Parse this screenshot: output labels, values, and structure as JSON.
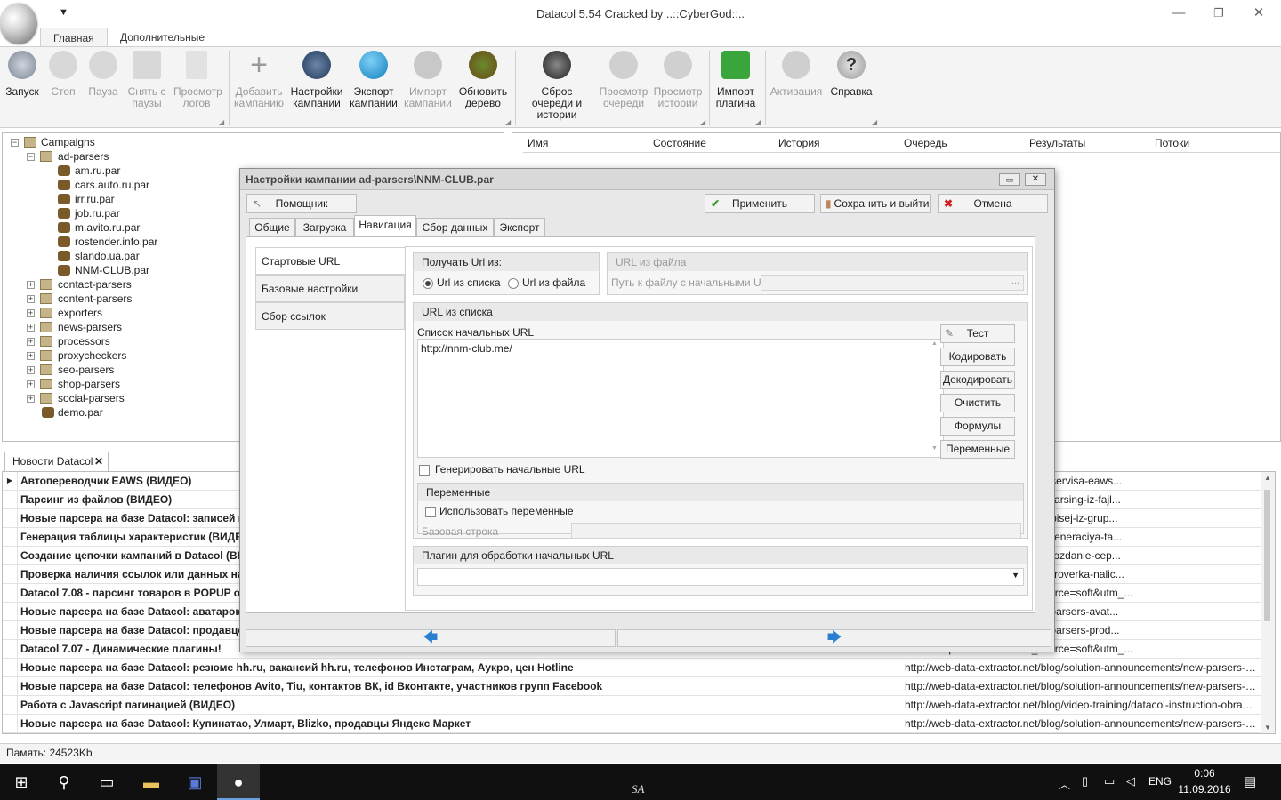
{
  "window": {
    "title": "Datacol 5.54 Cracked by ..::CyberGod::..",
    "qat": "▼"
  },
  "tabs": {
    "main": "Главная",
    "extra": "Дополнительные"
  },
  "ribbon": {
    "start": "Запуск",
    "stop": "Стоп",
    "pause": "Пауза",
    "unpause": "Снять с паузы",
    "logs": "Просмотр логов",
    "add": "Добавить кампанию",
    "settings": "Настройки кампании",
    "export": "Экспорт кампании",
    "import": "Импорт кампании",
    "refresh": "Обновить дерево",
    "reset": "Сброс очереди и истории",
    "queue": "Просмотр очереди",
    "history": "Просмотр истории",
    "plugin": "Импорт плагина",
    "activation": "Активация",
    "help": "Справка"
  },
  "tree": {
    "root": "Campaigns",
    "group": "ad-parsers",
    "children": [
      "am.ru.par",
      "cars.auto.ru.par",
      "irr.ru.par",
      "job.ru.par",
      "m.avito.ru.par",
      "rostender.info.par",
      "slando.ua.par",
      "NNM-CLUB.par"
    ],
    "folders": [
      "contact-parsers",
      "content-parsers",
      "exporters",
      "news-parsers",
      "processors",
      "proxycheckers",
      "seo-parsers",
      "shop-parsers",
      "social-parsers"
    ],
    "last": "demo.par"
  },
  "list": {
    "columns": [
      "Имя",
      "Состояние",
      "История",
      "Очередь",
      "Результаты",
      "Потоки"
    ]
  },
  "news": {
    "tab": "Новости Datacol",
    "rows": [
      {
        "t": "Автопереводчик EAWS (ВИДЕО)",
        "u": "operevod-kontenta-cherez-api-servisa-eaws..."
      },
      {
        "t": "Парсинг из файлов (ВИДЕО)",
        "u": "eo-training/datacol-instruction-parsing-iz-fajl..."
      },
      {
        "t": "Новые парсера на базе Datacol: записей из",
        "u": "ye-parsera-na-baze-datacol-zapisej-iz-grup..."
      },
      {
        "t": "Генерация таблицы характеристик (ВИДЕ",
        "u": "eo-training/datacol-instruction-generaciya-ta..."
      },
      {
        "t": "Создание цепочки кампаний в Datacol (ВИ",
        "u": "eo-training/datacol-instruction-sozdanie-cep..."
      },
      {
        "t": "Проверка наличия ссылок или данных на с",
        "u": "eo-training/datacol-instruction-proverka-nalic..."
      },
      {
        "t": "Datacol 7.08 - парсинг товаров в POPUP ок",
        "u": "datacol-updates/7-08/?utm_source=soft&utm_..."
      },
      {
        "t": "Новые парсера на базе Datacol: аватарок",
        "u": "/solution-announcements/new-parsers-avat..."
      },
      {
        "t": "Новые парсера на базе Datacol: продавцо",
        "u": "/solution-announcements/new-parsers-prod..."
      },
      {
        "t": "Datacol 7.07 - Динамические плагины!",
        "u": "datacol-updates/7-07/?utm_source=soft&utm_..."
      },
      {
        "t": "Новые парсера на базе Datacol: резюме hh.ru, вакансий hh.ru, телефонов Инстаграм, Аукро, цен Hotline",
        "u": "http://web-data-extractor.net/blog/solution-announcements/new-parsers-rezy..."
      },
      {
        "t": "Новые парсера на базе Datacol: телефонов Avito, Tiu, контактов ВК, id Вконтакте, участников групп Facebook",
        "u": "http://web-data-extractor.net/blog/solution-announcements/new-parsers-tele..."
      },
      {
        "t": "Работа с Javascript пагинацией (ВИДЕО)",
        "u": "http://web-data-extractor.net/blog/video-training/datacol-instruction-obrabotka-jav..."
      },
      {
        "t": "Новые парсера на базе Datacol: Купинатао, Улмарт, Blizko, продавцы Яндекс Маркет",
        "u": "http://web-data-extractor.net/blog/solution-announcements/new-parsers-kupi..."
      }
    ]
  },
  "status": "Память: 24523Kb",
  "dialog": {
    "title": "Настройки кампании ad-parsers\\NNM-CLUB.par",
    "helper": "Помощник",
    "apply": "Применить",
    "save_exit": "Сохранить и выйти",
    "cancel": "Отмена",
    "tabs": [
      "Общие",
      "Загрузка",
      "Навигация",
      "Сбор данных",
      "Экспорт"
    ],
    "side": [
      "Стартовые URL",
      "Базовые настройки навигации",
      "Сбор ссылок"
    ],
    "get_url_from": "Получать Url из:",
    "radio_list": "Url из списка",
    "radio_file": "Url из файла",
    "file_group": "URL из файла",
    "file_path_label": "Путь к файлу с начальными URL",
    "file_path_btn": "...",
    "list_group": "URL из списка",
    "start_list_label": "Список начальных URL",
    "urls": "http://nnm-club.me/",
    "btn_test": "Тест",
    "btn_encode": "Кодировать",
    "btn_decode": "Декодировать",
    "btn_clear": "Очистить",
    "btn_formulas": "Формулы",
    "btn_vars": "Переменные",
    "gen_urls": "Генерировать начальные URL",
    "vars_group": "Переменные",
    "use_vars": "Использовать переменные",
    "base_string": "Базовая строка",
    "plugin_group": "Плагин для обработки начальных URL",
    "back": "🡄",
    "forward": "🡆"
  },
  "taskbar": {
    "lang": "ENG",
    "time": "0:06",
    "date": "11.09.2016",
    "sa": "SA"
  }
}
